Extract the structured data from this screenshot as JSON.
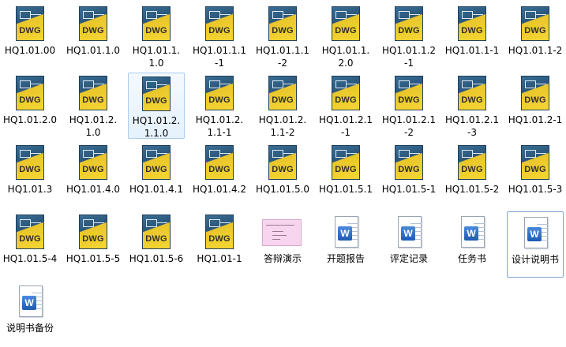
{
  "icon_kinds": {
    "dwg": {
      "badge": "DWG",
      "icon_name": "dwg-file-icon"
    },
    "doc": {
      "badge": "W",
      "icon_name": "word-document-icon"
    },
    "thumb": {
      "icon_name": "presentation-thumbnail-icon"
    }
  },
  "files": [
    {
      "name": "HQ1.01.00",
      "kind": "dwg"
    },
    {
      "name": "HQ1.01.1.0",
      "kind": "dwg"
    },
    {
      "name": "HQ1.01.1.1.0",
      "kind": "dwg"
    },
    {
      "name": "HQ1.01.1.1-1",
      "kind": "dwg"
    },
    {
      "name": "HQ1.01.1.1-2",
      "kind": "dwg"
    },
    {
      "name": "HQ1.01.1.2.0",
      "kind": "dwg"
    },
    {
      "name": "HQ1.01.1.2-1",
      "kind": "dwg"
    },
    {
      "name": "HQ1.01.1-1",
      "kind": "dwg"
    },
    {
      "name": "HQ1.01.1-2",
      "kind": "dwg"
    },
    {
      "name": "HQ1.01.2.0",
      "kind": "dwg"
    },
    {
      "name": "HQ1.01.2.1.0",
      "kind": "dwg"
    },
    {
      "name": "HQ1.01.2.1.1.0",
      "kind": "dwg",
      "selected": true
    },
    {
      "name": "HQ1.01.2.1.1-1",
      "kind": "dwg"
    },
    {
      "name": "HQ1.01.2.1.1-2",
      "kind": "dwg"
    },
    {
      "name": "HQ1.01.2.1-1",
      "kind": "dwg"
    },
    {
      "name": "HQ1.01.2.1-2",
      "kind": "dwg"
    },
    {
      "name": "HQ1.01.2.1-3",
      "kind": "dwg"
    },
    {
      "name": "HQ1.01.2-1",
      "kind": "dwg"
    },
    {
      "name": "HQ1.01.3",
      "kind": "dwg"
    },
    {
      "name": "HQ1.01.4.0",
      "kind": "dwg"
    },
    {
      "name": "HQ1.01.4.1",
      "kind": "dwg"
    },
    {
      "name": "HQ1.01.4.2",
      "kind": "dwg"
    },
    {
      "name": "HQ1.01.5.0",
      "kind": "dwg"
    },
    {
      "name": "HQ1.01.5.1",
      "kind": "dwg"
    },
    {
      "name": "HQ1.01.5-1",
      "kind": "dwg"
    },
    {
      "name": "HQ1.01.5-2",
      "kind": "dwg"
    },
    {
      "name": "HQ1.01.5-3",
      "kind": "dwg"
    },
    {
      "name": "HQ1.01.5-4",
      "kind": "dwg"
    },
    {
      "name": "HQ1.01.5-5",
      "kind": "dwg"
    },
    {
      "name": "HQ1.01.5-6",
      "kind": "dwg"
    },
    {
      "name": "HQ1.01-1",
      "kind": "dwg"
    },
    {
      "name": "答辩演示",
      "kind": "thumb"
    },
    {
      "name": "开题报告",
      "kind": "doc"
    },
    {
      "name": "评定记录",
      "kind": "doc"
    },
    {
      "name": "任务书",
      "kind": "doc"
    },
    {
      "name": "设计说明书",
      "kind": "doc",
      "outlined": true
    },
    {
      "name": "说明书备份",
      "kind": "doc"
    }
  ],
  "colors": {
    "selection_border": "#a9cdef",
    "outline_border": "#7da2ce",
    "dwg_blue": "#2a5679",
    "dwg_yellow": "#f5d633",
    "word_blue": "#1f5bb0",
    "thumb_pink": "#f7d5ee"
  }
}
